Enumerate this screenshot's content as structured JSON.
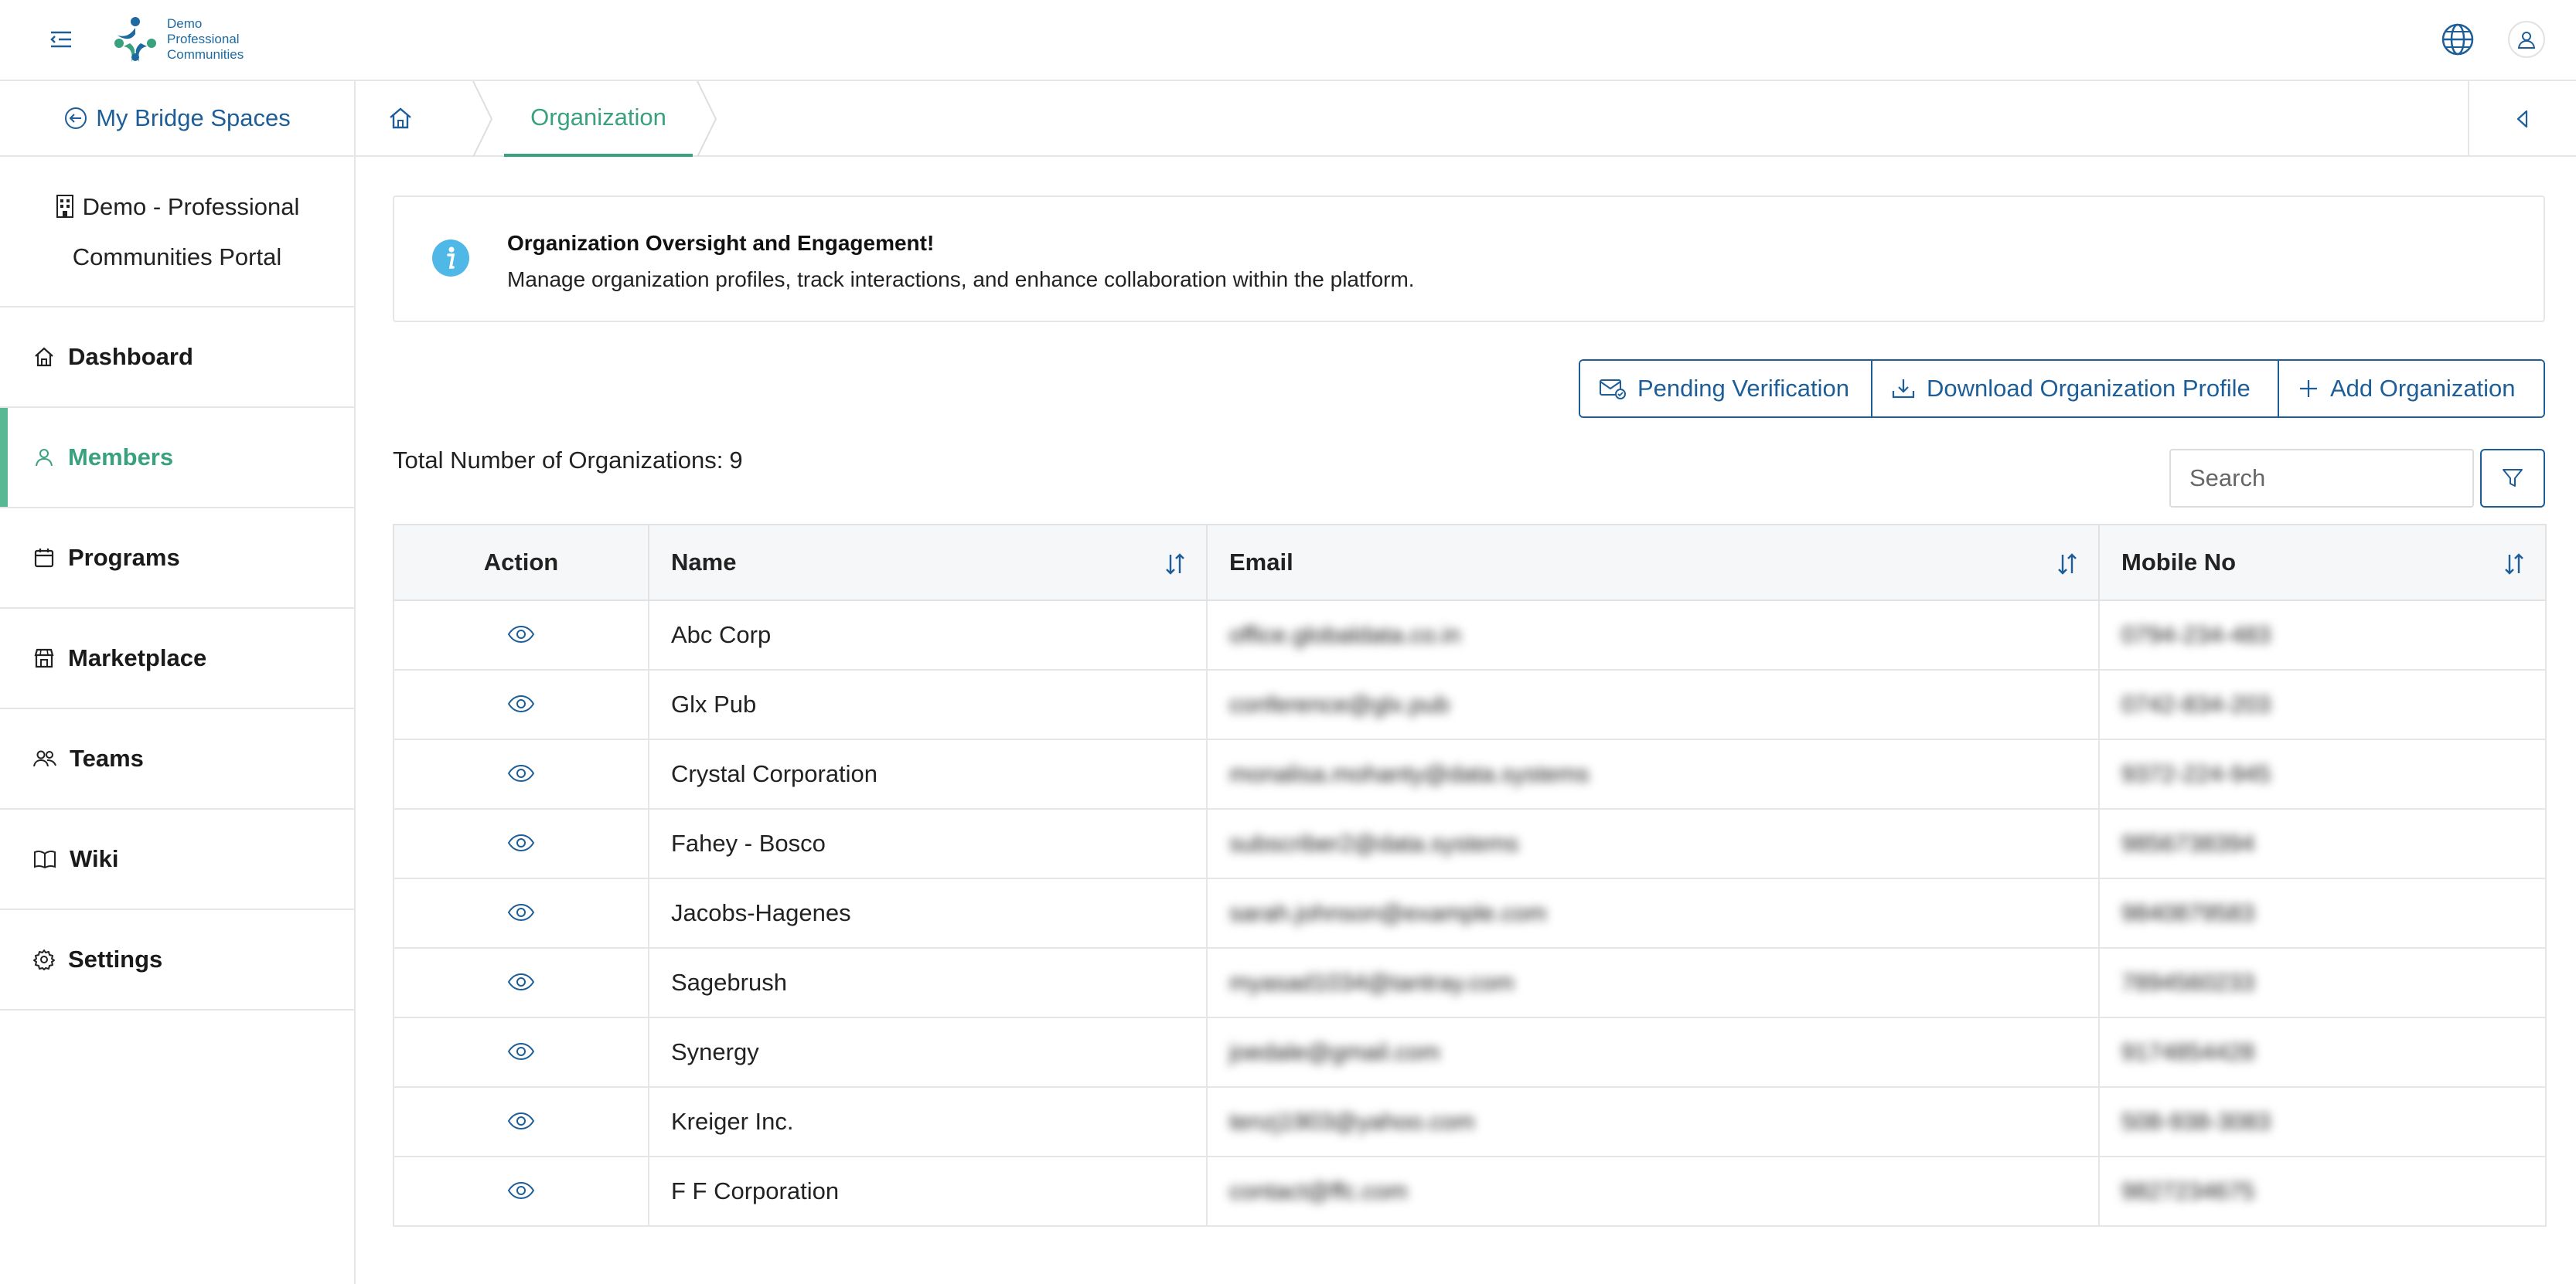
{
  "app": {
    "logo_text": [
      "Demo",
      "Professional",
      "Communities"
    ]
  },
  "sidebar": {
    "back_label": "My Bridge Spaces",
    "portal_line1": "Demo - Professional",
    "portal_line2": "Communities Portal",
    "items": [
      {
        "label": "Dashboard",
        "icon": "home-icon",
        "active": false
      },
      {
        "label": "Members",
        "icon": "user-icon",
        "active": true
      },
      {
        "label": "Programs",
        "icon": "calendar-icon",
        "active": false
      },
      {
        "label": "Marketplace",
        "icon": "store-icon",
        "active": false
      },
      {
        "label": "Teams",
        "icon": "team-icon",
        "active": false
      },
      {
        "label": "Wiki",
        "icon": "book-icon",
        "active": false
      },
      {
        "label": "Settings",
        "icon": "gear-icon",
        "active": false
      }
    ]
  },
  "breadcrumb": {
    "current": "Organization"
  },
  "banner": {
    "title": "Organization Oversight and Engagement!",
    "text": "Manage organization profiles, track interactions, and enhance collaboration within the platform."
  },
  "actions": {
    "pending": "Pending Verification",
    "download": "Download Organization Profile",
    "add": "Add Organization"
  },
  "summary": {
    "label": "Total Number of Organizations:",
    "count": "9"
  },
  "search": {
    "placeholder": "Search"
  },
  "table": {
    "columns": [
      "Action",
      "Name",
      "Email",
      "Mobile No"
    ],
    "rows": [
      {
        "name": "Abc Corp",
        "email": "office.globaldata.co.in",
        "mobile": "0794-234-483"
      },
      {
        "name": "Glx Pub",
        "email": "conference@glx.pub",
        "mobile": "0742-834-203"
      },
      {
        "name": "Crystal Corporation",
        "email": "monalisa.mohanty@data.systems",
        "mobile": "9372-224-945"
      },
      {
        "name": "Fahey - Bosco",
        "email": "subscriber2@data.systems",
        "mobile": "9856738394"
      },
      {
        "name": "Jacobs-Hagenes",
        "email": "sarah.johnson@example.com",
        "mobile": "9840879583"
      },
      {
        "name": "Sagebrush",
        "email": "myasad1034@tantray.com",
        "mobile": "7894560233"
      },
      {
        "name": "Synergy",
        "email": "joedale@gmail.com",
        "mobile": "9174854428"
      },
      {
        "name": "Kreiger Inc.",
        "email": "tenzj1903@yahoo.com",
        "mobile": "508-938-3083"
      },
      {
        "name": "F F Corporation",
        "email": "contact@ffc.com",
        "mobile": "9827234675"
      }
    ]
  },
  "colors": {
    "primary": "#1e5e98",
    "accent": "#3aa17e",
    "info": "#4fb8e6"
  }
}
